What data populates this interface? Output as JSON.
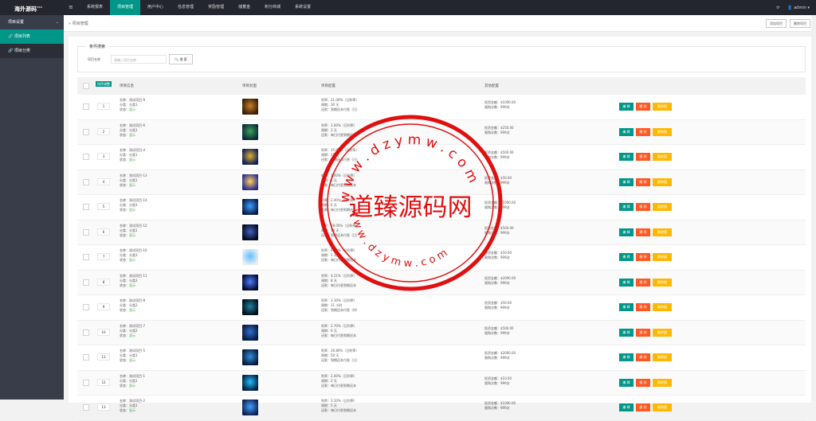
{
  "app": {
    "logo": "海外源码",
    "logo_sup": "PRO"
  },
  "nav": [
    "系统报表",
    "项目管理",
    "用户中心",
    "信息管理",
    "奖励管理",
    "储蓄金",
    "积分商城",
    "系统设置"
  ],
  "nav_active": 1,
  "top_right": {
    "refresh_icon": "refresh-icon",
    "user": "admin"
  },
  "sidebar": {
    "group": "项目设置",
    "items": [
      "项目列表",
      "项目分类"
    ],
    "active": 0
  },
  "breadcrumb": "项目管理",
  "crumb_buttons": [
    "添加项目",
    "删除项目"
  ],
  "search": {
    "legend": "条件搜索",
    "label": "项目名称",
    "placeholder": "请输入项目名称",
    "button": "搜 索"
  },
  "table": {
    "headers": [
      "项目信息",
      "项目封面",
      "项目配置",
      "其他配置"
    ],
    "sort_tag": "排序调整",
    "ops": [
      "编 辑",
      "删 除",
      "删除图"
    ],
    "rows": [
      {
        "sort": "1",
        "name": "名称：测试项目-9",
        "cat": "分类：分类1",
        "status": "状态：",
        "status_val": "显示",
        "rate": "利率：21.00%（日利率）",
        "period": "周期：30 天",
        "repay": "还款：到期还本付息（日）",
        "invest": "投资金额：$1000.00",
        "limit": "限购次数：999次",
        "c1": "#c8812a",
        "c2": "#3a1e05"
      },
      {
        "sort": "2",
        "name": "名称：测试项目-6",
        "cat": "分类：分类1",
        "status": "状态：",
        "status_val": "显示",
        "rate": "利率：3.00%（日利率）",
        "period": "周期：3 天",
        "repay": "还款：每日付息到期还本",
        "invest": "投资金额：$250.00",
        "limit": "限购次数：999次",
        "c1": "#3aa35a",
        "c2": "#0b2a3a"
      },
      {
        "sort": "3",
        "name": "名称：测试项目-4",
        "cat": "分类：分类1",
        "status": "状态：",
        "status_val": "显示",
        "rate": "利率：15.00%（日利率）",
        "period": "周期：15 天",
        "repay": "还款：到期还本付息（日）",
        "invest": "投资金额：$500.00",
        "limit": "限购次数：999次",
        "c1": "#e0b030",
        "c2": "#10205a"
      },
      {
        "sort": "4",
        "name": "名称：测试项目-13",
        "cat": "分类：分类1",
        "status": "状态：",
        "status_val": "显示",
        "rate": "利率：1.00%（日利率）",
        "period": "周期：1 天",
        "repay": "还款：每日付息到期还本",
        "invest": "投资金额：$50.00",
        "limit": "限购次数：999次",
        "c1": "#ffd060",
        "c2": "#2a2e8a"
      },
      {
        "sort": "5",
        "name": "名称：测试项目-14",
        "cat": "分类：分类3",
        "status": "状态：",
        "status_val": "显示",
        "rate": "利率：2.40%（日利率）",
        "period": "周期：6 天",
        "repay": "还款：每日付息到期还本",
        "invest": "投资金额：$1000.00",
        "limit": "限购次数：999次",
        "c1": "#3aa0ff",
        "c2": "#0a1a4a"
      },
      {
        "sort": "6",
        "name": "名称：测试项目-12",
        "cat": "分类：分类1",
        "status": "状态：",
        "status_val": "显示",
        "rate": "利率：18.00%（日利率）",
        "period": "周期：18 天",
        "repay": "还款：到期还本付息（日）",
        "invest": "投资金额：$500.00",
        "limit": "限购次数：999次",
        "c1": "#4060c0",
        "c2": "#050a20"
      },
      {
        "sort": "7",
        "name": "名称：测试项目-10",
        "cat": "分类：分类3",
        "status": "状态：",
        "status_val": "显示",
        "rate": "利率：0.70%（日利率）",
        "period": "周期：1 天",
        "repay": "还款：每日付息到期还本",
        "invest": "投资金额：$50.00",
        "limit": "限购次数：999次",
        "c1": "#60c0ff",
        "c2": "#e8eef5"
      },
      {
        "sort": "8",
        "name": "名称：测试项目-11",
        "cat": "分类：分类3",
        "status": "状态：",
        "status_val": "显示",
        "rate": "利率：4.21%（日利率）",
        "period": "周期：8 天",
        "repay": "还款：每日付息到期还本",
        "invest": "投资金额：$2000.00",
        "limit": "限购次数：999次",
        "c1": "#4a80ff",
        "c2": "#050a30"
      },
      {
        "sort": "9",
        "name": "名称：测试项目-8",
        "cat": "分类：分类2",
        "status": "状态：",
        "status_val": "显示",
        "rate": "利率：3.10%（日利率）",
        "period": "周期：11 小时",
        "repay": "还款：到期还本付息（时）",
        "invest": "投资金额：$50.00",
        "limit": "限购次数：999次",
        "c1": "#2080a0",
        "c2": "#02101a"
      },
      {
        "sort": "10",
        "name": "名称：测试项目-7",
        "cat": "分类：分类2",
        "status": "状态：",
        "status_val": "显示",
        "rate": "利率：2.70%（日利率）",
        "period": "周期：6 天",
        "repay": "还款：每日付息到期还本",
        "invest": "投资金额：$500.00",
        "limit": "限购次数：999次",
        "c1": "#3070d0",
        "c2": "#081a40"
      },
      {
        "sort": "11",
        "name": "名称：测试项目-5",
        "cat": "分类：分类1",
        "status": "状态：",
        "status_val": "显示",
        "rate": "利率：26.80%（日利率）",
        "period": "周期：50 天",
        "repay": "还款：到期还本付息（日）",
        "invest": "投资金额：$2000.00",
        "limit": "限购次数：999次",
        "c1": "#3090e0",
        "c2": "#0a1a3a"
      },
      {
        "sort": "12",
        "name": "名称：测试项目-1",
        "cat": "分类：分类1",
        "status": "状态：",
        "status_val": "显示",
        "rate": "利率：2.00%（日利率）",
        "period": "周期：2 天",
        "repay": "还款：每日付息到期还本",
        "invest": "投资金额：$10.00",
        "limit": "限购次数：999次",
        "c1": "#20c0ff",
        "c2": "#052040"
      },
      {
        "sort": "13",
        "name": "名称：测试项目-2",
        "cat": "分类：分类1",
        "status": "状态：",
        "status_val": "显示",
        "rate": "利率：3.10%（日利率）",
        "period": "周期：5 天",
        "repay": "还款：每日付息到期还本",
        "invest": "投资金额：$1000.00",
        "limit": "限购次数：999次",
        "c1": "#40a0ff",
        "c2": "#102050"
      }
    ]
  },
  "watermark": {
    "top_text": "w w w . d z y m w . c o m",
    "center_text": "道臻源码网",
    "bottom_text": "w w w . d z y m w . c o m",
    "color": "#e01010"
  }
}
